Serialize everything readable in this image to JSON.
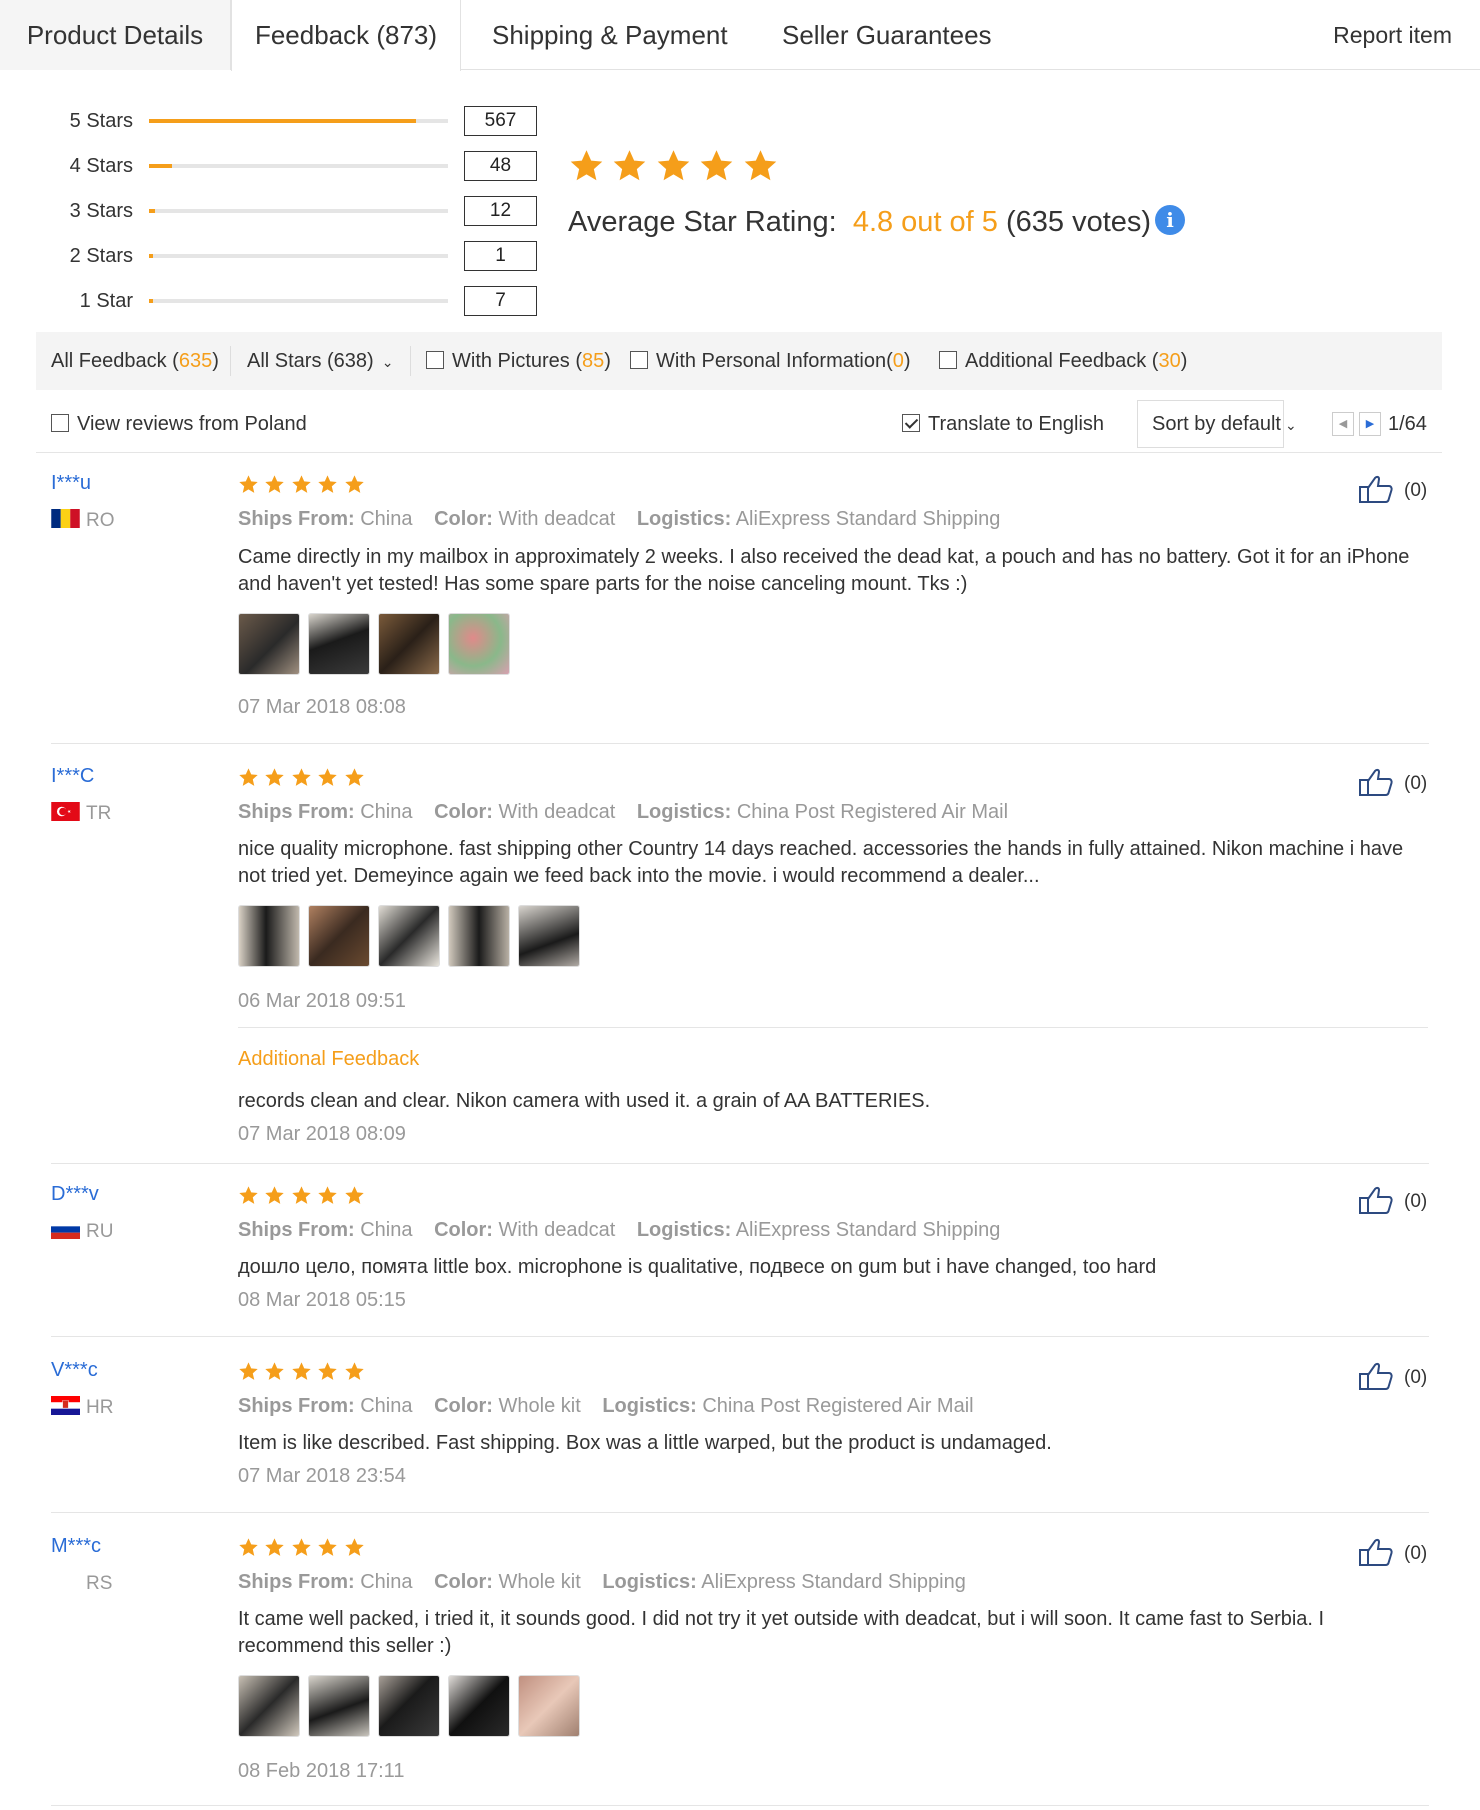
{
  "tabs": [
    {
      "label": "Product Details"
    },
    {
      "label": "Feedback (873)"
    },
    {
      "label": "Shipping & Payment"
    },
    {
      "label": "Seller Guarantees"
    }
  ],
  "report_label": "Report item",
  "rating": {
    "rows": [
      {
        "label": "5 Stars",
        "count": "567",
        "fill": 0.893
      },
      {
        "label": "4 Stars",
        "count": "48",
        "fill": 0.076
      },
      {
        "label": "3 Stars",
        "count": "12",
        "fill": 0.019
      },
      {
        "label": "2 Stars",
        "count": "1",
        "fill": 0.002
      },
      {
        "label": "1 Star",
        "count": "7",
        "fill": 0.011
      }
    ],
    "avg_label": "Average Star Rating:",
    "avg_value": "4.8 out of 5",
    "votes": "(635 votes)",
    "star_color": "#f59e1a"
  },
  "filters": {
    "all_feedback": "All Feedback (",
    "all_feedback_num": "635",
    "close": ")",
    "all_stars": "All Stars (638)",
    "with_pictures": "With Pictures (",
    "with_pictures_num": "85",
    "personal": "With Personal Information(",
    "personal_num": "0",
    "additional": "Additional Feedback (",
    "additional_num": "30"
  },
  "controls": {
    "view_poland": "View reviews from Poland",
    "translate": "Translate to English",
    "sort": "Sort by default",
    "page": "1/64"
  },
  "reviews": [
    {
      "user": "I***u",
      "country": "RO",
      "ships_label": "Ships From:",
      "ships": "China",
      "color_label": "Color:",
      "color": "With deadcat",
      "logistics_label": "Logistics:",
      "logistics": "AliExpress Standard Shipping",
      "text": "Came directly in my mailbox in approximately 2 weeks. I also received the dead kat, a pouch and has no battery. Got it for an iPhone and haven't yet tested! Has some spare parts for the noise canceling mount. Tks :)",
      "date": "07 Mar 2018 08:08",
      "likes": "(0)"
    },
    {
      "user": "I***C",
      "country": "TR",
      "ships_label": "Ships From:",
      "ships": "China",
      "color_label": "Color:",
      "color": "With deadcat",
      "logistics_label": "Logistics:",
      "logistics": "China Post Registered Air Mail",
      "text": "nice quality microphone. fast shipping other Country 14 days reached. accessories the hands in fully attained. Nikon machine i have not tried yet. Demeyince again we feed back into the movie. i would recommend a dealer...",
      "date": "06 Mar 2018 09:51",
      "additional_title": "Additional Feedback",
      "additional_text": "records clean and clear. Nikon camera with used it. a grain of AA BATTERIES.",
      "additional_date": "07 Mar 2018 08:09",
      "likes": "(0)"
    },
    {
      "user": "D***v",
      "country": "RU",
      "ships_label": "Ships From:",
      "ships": "China",
      "color_label": "Color:",
      "color": "With deadcat",
      "logistics_label": "Logistics:",
      "logistics": "AliExpress Standard Shipping",
      "text": "дошло цело, помята little box. microphone is qualitative, подвесе on gum but i have changed, too hard",
      "date": "08 Mar 2018 05:15",
      "likes": "(0)"
    },
    {
      "user": "V***c",
      "country": "HR",
      "ships_label": "Ships From:",
      "ships": "China",
      "color_label": "Color:",
      "color": "Whole kit",
      "logistics_label": "Logistics:",
      "logistics": "China Post Registered Air Mail",
      "text": "Item is like described. Fast shipping. Box was a little warped, but the product is undamaged.",
      "date": "07 Mar 2018 23:54",
      "likes": "(0)"
    },
    {
      "user": "M***c",
      "country": "RS",
      "ships_label": "Ships From:",
      "ships": "China",
      "color_label": "Color:",
      "color": "Whole kit",
      "logistics_label": "Logistics:",
      "logistics": "AliExpress Standard Shipping",
      "text": "It came well packed, i tried it, it sounds good. I did not try it yet outside with deadcat, but i will soon. It came fast to Serbia. I recommend this seller :)",
      "date": "08 Feb 2018 17:11",
      "likes": "(0)"
    }
  ]
}
